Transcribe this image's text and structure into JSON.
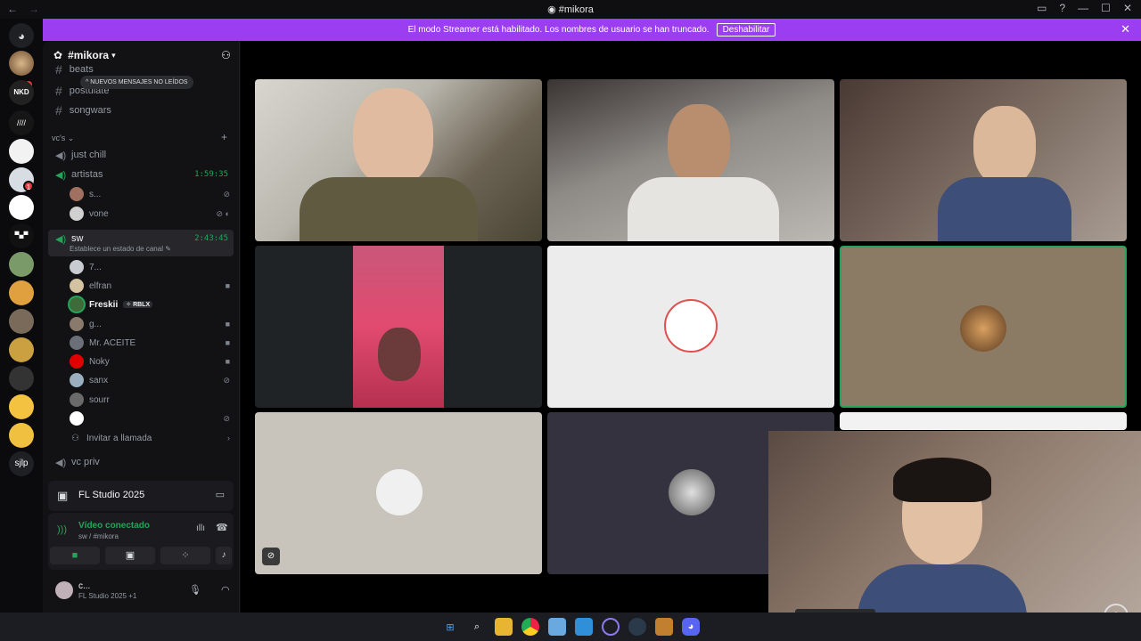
{
  "window": {
    "title": "#mikora",
    "back": "←",
    "forward": "→"
  },
  "banner": {
    "text": "El modo Streamer está habilitado. Los nombres de usuario se han truncado.",
    "button": "Deshabilitar"
  },
  "sidebar": {
    "guild_name": "#mikora",
    "unread_pill": "NUEVOS MENSAJES NO LEÍDOS",
    "text_channels": [
      "beats",
      "postulate",
      "songwars"
    ],
    "category": "vc's",
    "voice_channels": [
      {
        "name": "just chill",
        "timer": ""
      },
      {
        "name": "artistas",
        "timer": "1:59:35"
      },
      {
        "name": "sw",
        "timer": "2:43:45"
      }
    ],
    "artistas_members": [
      "s...",
      "vone"
    ],
    "sw_status": "Establece un estado de canal",
    "sw_members": [
      {
        "name": "7...",
        "color": "#c8ccd2"
      },
      {
        "name": "elfran",
        "color": "#d3c3a0"
      },
      {
        "name": "Freskii",
        "color": "#3f6b3a",
        "tag": "RBLX"
      },
      {
        "name": "g...",
        "color": "#8a7a6c"
      },
      {
        "name": "Mr. ACEITE",
        "color": "#6b6f78"
      },
      {
        "name": "Noky",
        "color": "#e00000"
      },
      {
        "name": "sanx",
        "color": "#9ab0c0"
      },
      {
        "name": "sourr",
        "color": "#6a6a6a"
      },
      {
        "name": "",
        "color": "#ffffff"
      }
    ],
    "invite": "Invitar a llamada",
    "vc_priv": "vc priv",
    "activity": "FL Studio 2025",
    "voice_status": "Vídeo conectado",
    "voice_location": "sw / #mikora",
    "user_name": "c...",
    "user_activity": "FL Studio 2025 +1"
  },
  "colors": {
    "accent": "#9b3ef2",
    "green": "#23a559"
  },
  "taskbar_icons": [
    "windows-icon",
    "search-icon",
    "folder-icon",
    "chrome-icon",
    "notepad-icon",
    "app-icon",
    "cortana-icon",
    "steam-icon",
    "shield-icon",
    "discord-icon"
  ]
}
